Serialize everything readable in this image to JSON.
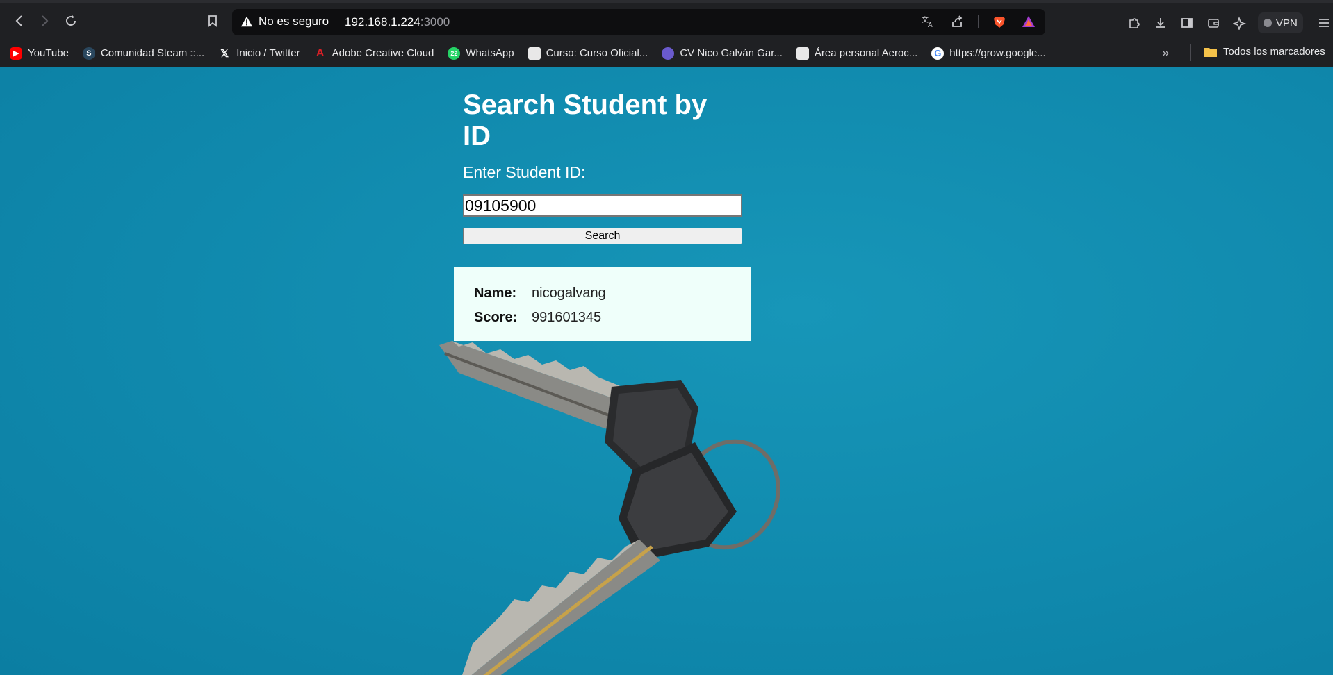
{
  "browser": {
    "url_warning": "No es seguro",
    "url_host": "192.168.1.224",
    "url_port": ":3000",
    "vpn_label": "VPN",
    "accent_brave": "#fb542b"
  },
  "bookmarks": {
    "items": [
      {
        "label": "YouTube",
        "icon": "youtube-icon",
        "color": "#ff0000"
      },
      {
        "label": "Comunidad Steam ::...",
        "icon": "steam-icon",
        "color": "#1b2838"
      },
      {
        "label": "Inicio / Twitter",
        "icon": "x-icon",
        "color": "#000000"
      },
      {
        "label": "Adobe Creative Cloud",
        "icon": "adobe-icon",
        "color": "#da1f26"
      },
      {
        "label": "WhatsApp",
        "icon": "whatsapp-icon",
        "color": "#25d366",
        "badge": "22"
      },
      {
        "label": "Curso: Curso Oficial...",
        "icon": "course-icon",
        "color": "#e8e8e8"
      },
      {
        "label": "CV Nico Galván Gar...",
        "icon": "cv-icon",
        "color": "#6a5acd"
      },
      {
        "label": "Área personal Aeroc...",
        "icon": "aero-icon",
        "color": "#e8e8e8"
      },
      {
        "label": "https://grow.google...",
        "icon": "google-icon",
        "color": "#4285f4"
      }
    ],
    "all_label": "Todos los marcadores"
  },
  "page": {
    "title": "Search Student by ID",
    "input_label": "Enter Student ID:",
    "input_value": "09105900",
    "search_button": "Search",
    "result": {
      "name_label": "Name:",
      "name_value": "nicogalvang",
      "score_label": "Score:",
      "score_value": "991601345"
    }
  }
}
